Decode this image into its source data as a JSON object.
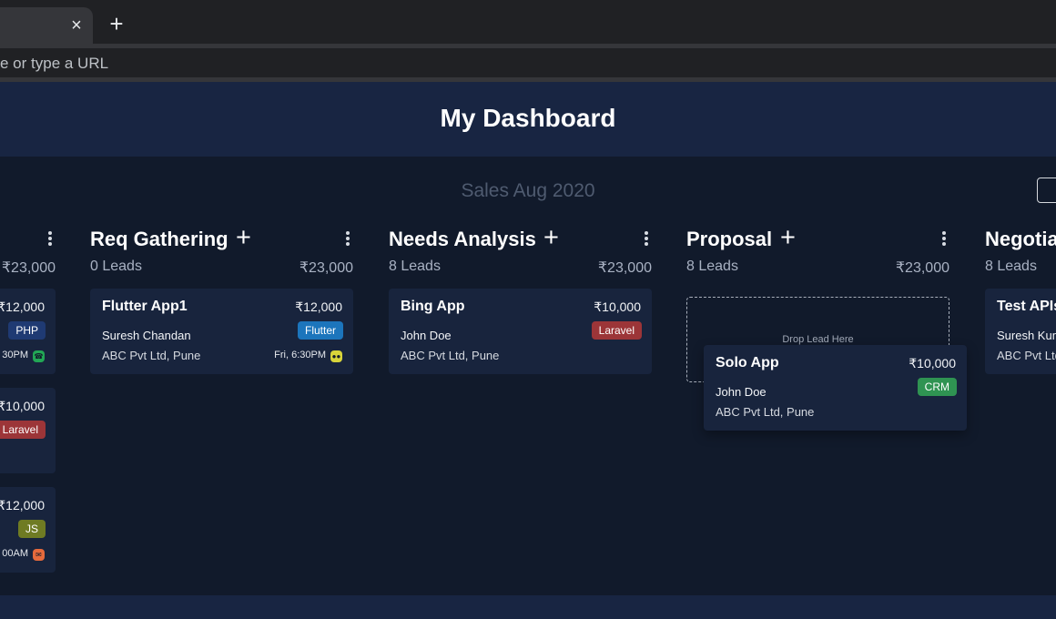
{
  "browser": {
    "tab_close": "×",
    "new_tab": "+",
    "address_placeholder": "e or type a URL"
  },
  "page": {
    "title": "My Dashboard",
    "subtitle": "Sales Aug 2020"
  },
  "columns": [
    {
      "title": "",
      "lead_count": "",
      "amount": "₹23,000",
      "cards": [
        {
          "title": "",
          "value": "₹12,000",
          "person": "",
          "company": "",
          "tag": "PHP",
          "tag_color": "#1f3a73",
          "time": "30PM",
          "time_icon": "phone-icon",
          "time_icon_color": "#22a755"
        },
        {
          "title": "",
          "value": "₹10,000",
          "person": "",
          "company": "",
          "tag": "Laravel",
          "tag_color": "#9c3538",
          "time": "",
          "time_icon": "",
          "time_icon_color": ""
        },
        {
          "title": "",
          "value": "₹12,000",
          "person": "",
          "company": "",
          "tag": "JS",
          "tag_color": "#6f7b23",
          "time": "00AM",
          "time_icon": "mail-icon",
          "time_icon_color": "#e66a3c"
        }
      ]
    },
    {
      "title": "Req Gathering",
      "add_label": "+",
      "lead_count": "0 Leads",
      "amount": "₹23,000",
      "cards": [
        {
          "title": "Flutter App1",
          "value": "₹12,000",
          "person": "Suresh Chandan",
          "company": "ABC Pvt Ltd, Pune",
          "tag": "Flutter",
          "tag_color": "#1c75bc",
          "time": "Fri, 6:30PM",
          "time_icon": "meeting-icon",
          "time_icon_color": "#d8d43a"
        }
      ]
    },
    {
      "title": "Needs Analysis",
      "add_label": "+",
      "lead_count": "8 Leads",
      "amount": "₹23,000",
      "cards": [
        {
          "title": "Bing App",
          "value": "₹10,000",
          "person": "John Doe",
          "company": "ABC Pvt Ltd, Pune",
          "tag": "Laravel",
          "tag_color": "#9c3538",
          "time": "",
          "time_icon": "",
          "time_icon_color": ""
        }
      ]
    },
    {
      "title": "Proposal",
      "add_label": "+",
      "lead_count": "8 Leads",
      "amount": "₹23,000",
      "drop_zone": "Drop Lead Here",
      "dragged_card": {
        "title": "Solo App",
        "value": "₹10,000",
        "person": "John Doe",
        "company": "ABC Pvt Ltd, Pune",
        "tag": "CRM",
        "tag_color": "#2f9352"
      }
    },
    {
      "title": "Negotia",
      "lead_count": "8 Leads",
      "amount": "",
      "cards": [
        {
          "title": "Test APIs",
          "value": "",
          "person": "Suresh Kum",
          "company": "ABC Pvt Ltd",
          "tag": "",
          "tag_color": ""
        }
      ]
    }
  ],
  "colors": {
    "background": "#111a2b",
    "header": "#182542",
    "card": "#18243d"
  }
}
